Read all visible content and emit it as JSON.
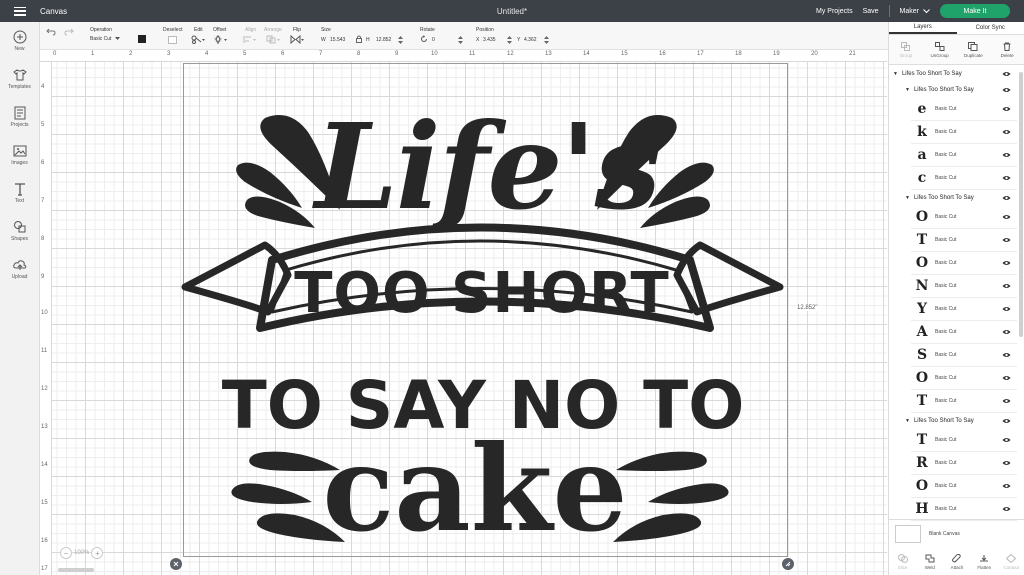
{
  "topbar": {
    "app_name": "Canvas",
    "doc_title": "Untitled*",
    "my_projects": "My Projects",
    "save": "Save",
    "machine": "Maker",
    "make_it": "Make It"
  },
  "sidebar": {
    "items": [
      {
        "label": "New",
        "icon": "plus-circle-icon"
      },
      {
        "label": "Templates",
        "icon": "shirt-icon"
      },
      {
        "label": "Projects",
        "icon": "projects-icon"
      },
      {
        "label": "Images",
        "icon": "image-icon"
      },
      {
        "label": "Text",
        "icon": "text-icon"
      },
      {
        "label": "Shapes",
        "icon": "shapes-icon"
      },
      {
        "label": "Upload",
        "icon": "upload-icon"
      }
    ]
  },
  "toolbar": {
    "operation_label": "Operation",
    "operation_value": "Basic Cut",
    "deselect": "Deselect",
    "edit": "Edit",
    "offset": "Offset",
    "align": "Align",
    "arrange": "Arrange",
    "flip": "Flip",
    "size_label": "Size",
    "w_label": "W",
    "w_value": "15.543",
    "h_label": "H",
    "h_value": "12.852",
    "rotate_label": "Rotate",
    "rotate_value": "0",
    "position_label": "Position",
    "x_label": "X",
    "x_value": "3.435",
    "y_label": "Y",
    "y_value": "4.362",
    "color": "#222222"
  },
  "canvas": {
    "ruler_top": [
      "0",
      "1",
      "2",
      "3",
      "4",
      "5",
      "6",
      "7",
      "8",
      "9",
      "10",
      "11",
      "12",
      "13",
      "14",
      "15",
      "16",
      "17",
      "18",
      "19",
      "20",
      "21"
    ],
    "ruler_left": [
      "4",
      "5",
      "6",
      "7",
      "8",
      "9",
      "10",
      "11",
      "12",
      "13",
      "14",
      "15",
      "16",
      "17"
    ],
    "dimension_label": "12.852\"",
    "zoom": "100%",
    "artwork": {
      "line1": "Life's",
      "line2": "TOO SHORT",
      "line3": "TO SAY NO TO",
      "line4": "cake"
    }
  },
  "panel": {
    "tabs": [
      "Layers",
      "Color Sync"
    ],
    "actions": [
      "Group",
      "UnGroup",
      "Duplicate",
      "Delete"
    ],
    "root_group": "Lifes Too Short To Say",
    "groups": [
      {
        "name": "Lifes Too Short To Say",
        "items": [
          {
            "glyph": "e",
            "op": "Basic Cut"
          },
          {
            "glyph": "k",
            "op": "Basic Cut"
          },
          {
            "glyph": "a",
            "op": "Basic Cut"
          },
          {
            "glyph": "c",
            "op": "Basic Cut"
          }
        ]
      },
      {
        "name": "Lifes Too Short To Say",
        "items": [
          {
            "glyph": "O",
            "op": "Basic Cut"
          },
          {
            "glyph": "T",
            "op": "Basic Cut"
          },
          {
            "glyph": "O",
            "op": "Basic Cut"
          },
          {
            "glyph": "N",
            "op": "Basic Cut"
          },
          {
            "glyph": "Y",
            "op": "Basic Cut"
          },
          {
            "glyph": "A",
            "op": "Basic Cut"
          },
          {
            "glyph": "S",
            "op": "Basic Cut"
          },
          {
            "glyph": "O",
            "op": "Basic Cut"
          },
          {
            "glyph": "T",
            "op": "Basic Cut"
          }
        ]
      },
      {
        "name": "Lifes Too Short To Say",
        "items": [
          {
            "glyph": "T",
            "op": "Basic Cut"
          },
          {
            "glyph": "R",
            "op": "Basic Cut"
          },
          {
            "glyph": "O",
            "op": "Basic Cut"
          },
          {
            "glyph": "H",
            "op": "Basic Cut"
          }
        ]
      }
    ],
    "blank_canvas": "Blank Canvas",
    "bottom_actions": [
      "Slice",
      "Weld",
      "Attach",
      "Flatten",
      "Contour"
    ]
  }
}
